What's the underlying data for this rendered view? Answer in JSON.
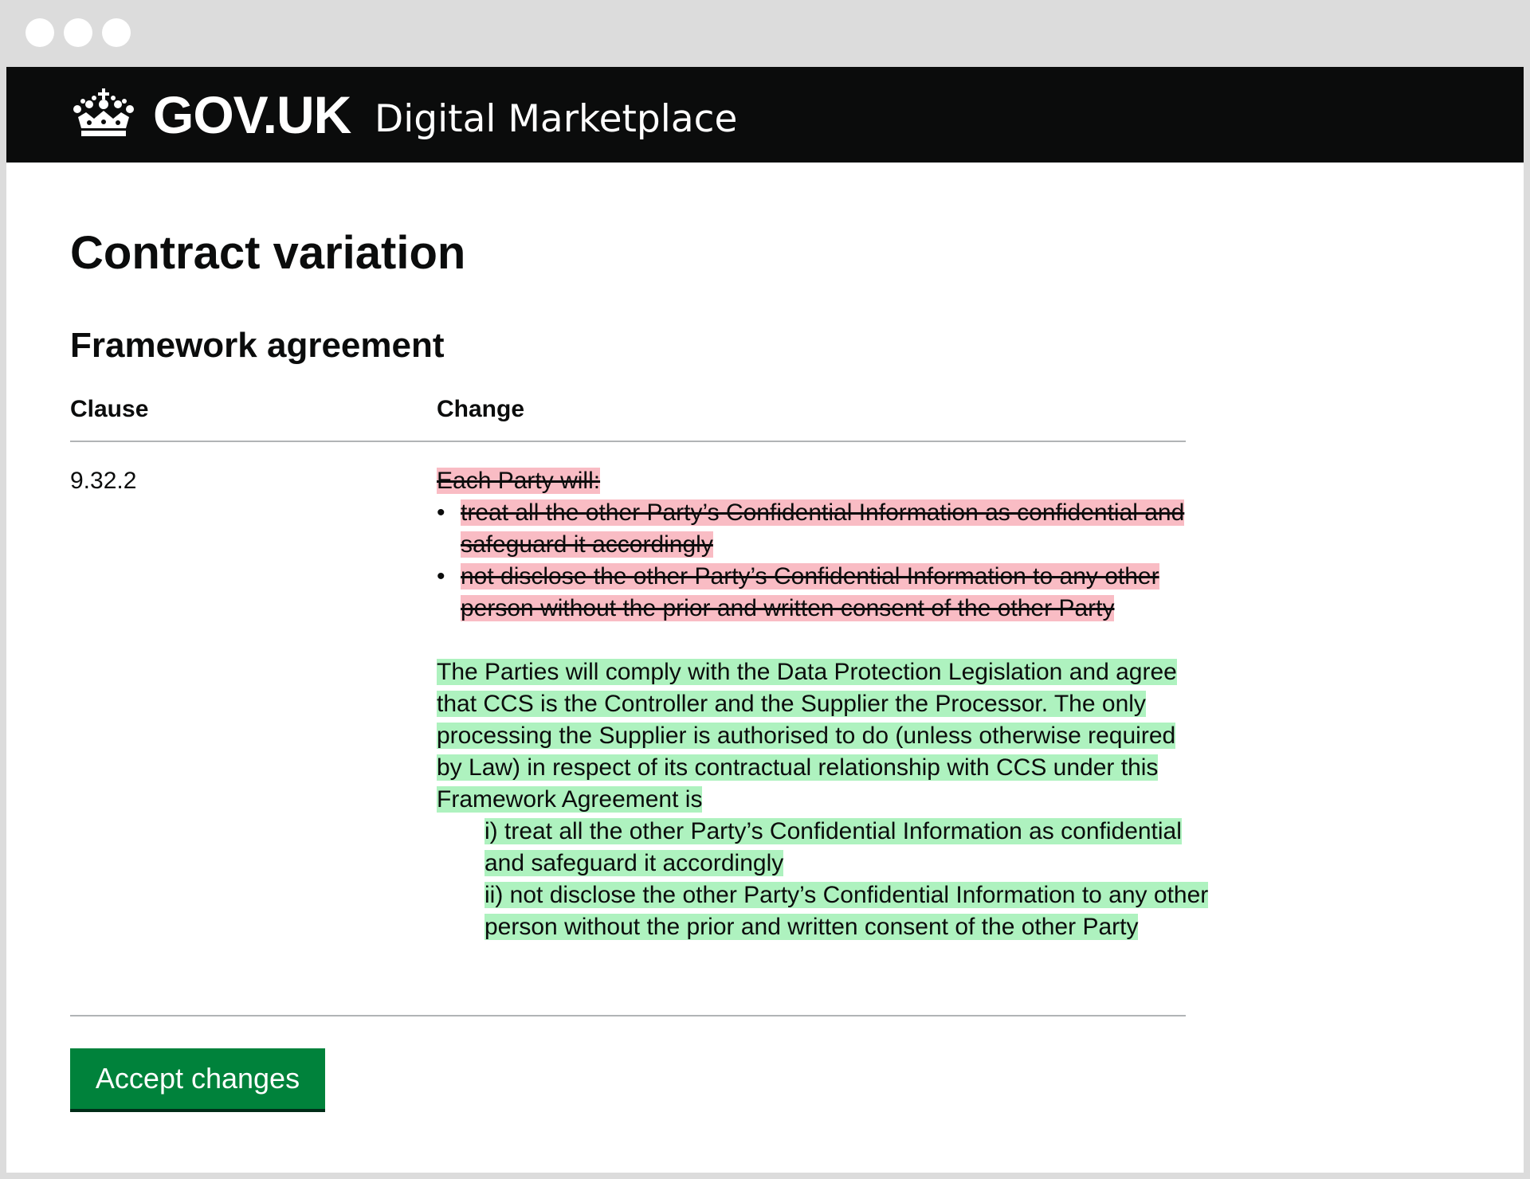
{
  "header": {
    "logo_text": "GOV.UK",
    "service_name": "Digital Marketplace",
    "background": "#0b0c0c"
  },
  "page": {
    "title": "Contract variation",
    "section_title": "Framework agreement"
  },
  "table": {
    "columns": [
      "Clause",
      "Change"
    ],
    "rows": [
      {
        "clause": "9.32.2",
        "deleted": {
          "intro": "Each Party will:",
          "items": [
            "treat all the other Party’s Confidential Information as confidential and safeguard it accordingly",
            "not disclose the other Party’s Confidential Information to any other person without the prior and written consent of the other Party"
          ]
        },
        "inserted": {
          "paragraph": "The Parties will comply with the Data Protection Legislation and agree that CCS is the Controller and the Supplier the Processor. The only processing the Supplier is authorised to do (unless otherwise required by Law) in respect of its contractual relationship with CCS under this Framework Agreement is",
          "items": [
            "i) treat all the other Party’s Confidential Information as confidential and safeguard it accordingly",
            "ii) not disclose the other Party’s Confidential Information to any other person without the prior and written consent of the other Party"
          ]
        }
      }
    ]
  },
  "actions": {
    "accept_label": "Accept changes"
  },
  "colors": {
    "deleted_bg": "#f9bcc4",
    "inserted_bg": "#aef2bf",
    "button_green": "#00823b"
  }
}
